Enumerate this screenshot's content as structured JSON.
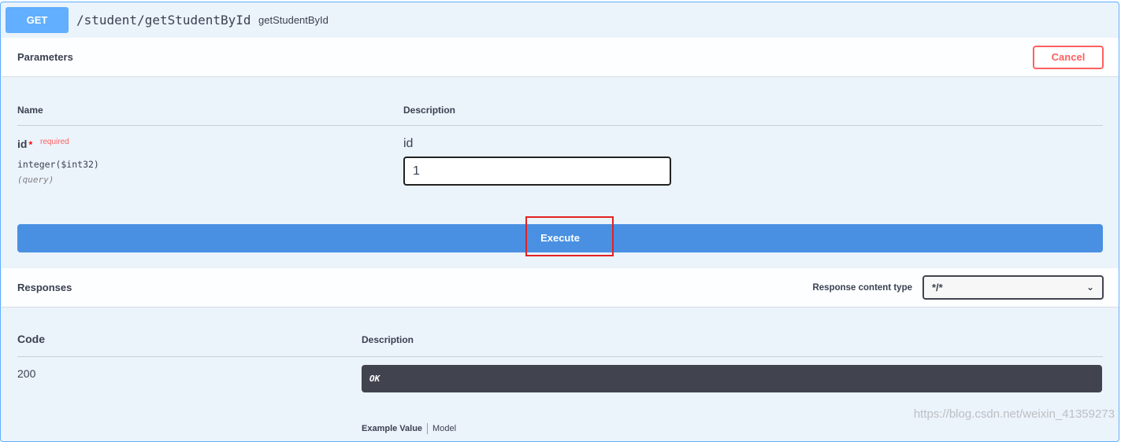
{
  "endpoint": {
    "method": "GET",
    "path": "/student/getStudentById",
    "description": "getStudentById"
  },
  "parameters": {
    "title": "Parameters",
    "cancel_label": "Cancel",
    "col_name": "Name",
    "col_description": "Description",
    "param": {
      "name": "id",
      "required_star": "*",
      "required_label": "required",
      "type": "integer($int32)",
      "location": "(query)",
      "description": "id",
      "value": "1"
    },
    "execute_label": "Execute"
  },
  "responses": {
    "title": "Responses",
    "content_type_label": "Response content type",
    "content_type_value": "*/*",
    "col_code": "Code",
    "col_description": "Description",
    "rows": [
      {
        "code": "200",
        "description": "OK"
      }
    ],
    "example_value_tab": "Example Value",
    "model_tab": "Model"
  },
  "watermark": "https://blog.csdn.net/weixin_41359273",
  "colors": {
    "get_blue": "#61affe",
    "execute_blue": "#4990e2",
    "cancel_red": "#ff6060",
    "dark_box": "#41444e",
    "highlight_red": "#e32222"
  }
}
